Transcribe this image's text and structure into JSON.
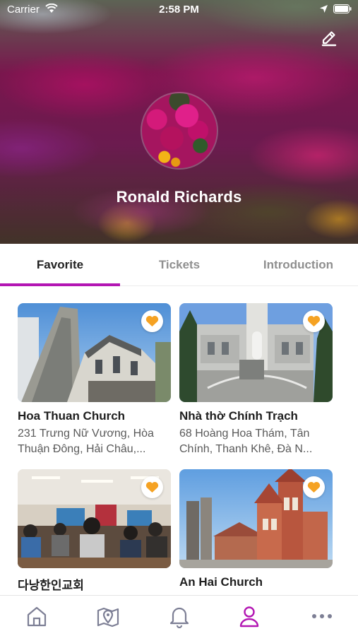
{
  "status_bar": {
    "carrier": "Carrier",
    "time": "2:58 PM"
  },
  "profile": {
    "name": "Ronald Richards"
  },
  "tabs": [
    {
      "label": "Favorite",
      "active": true
    },
    {
      "label": "Tickets",
      "active": false
    },
    {
      "label": "Introduction",
      "active": false
    }
  ],
  "favorites": [
    {
      "title": "Hoa Thuan Church",
      "address_line1": "231 Trưng Nữ Vương, Hòa",
      "address_line2": "Thuận Đông, Hải Châu,...",
      "favorited": true
    },
    {
      "title": "Nhà thờ Chính Trạch",
      "address_line1": "68 Hoàng Hoa Thám, Tân",
      "address_line2": "Chính, Thanh Khê, Đà N...",
      "favorited": true
    },
    {
      "title": "다낭한인교회",
      "address_line1": "",
      "address_line2": "",
      "favorited": true
    },
    {
      "title": "An Hai Church",
      "address_line1": "",
      "address_line2": "",
      "favorited": true
    }
  ],
  "colors": {
    "accent": "#b316b3",
    "heart": "#f5a223",
    "nav_inactive": "#7d7f95"
  },
  "bottom_nav": [
    {
      "icon": "home-icon",
      "active": false
    },
    {
      "icon": "map-pin-icon",
      "active": false
    },
    {
      "icon": "bell-icon",
      "active": false
    },
    {
      "icon": "profile-icon",
      "active": true
    },
    {
      "icon": "more-icon",
      "active": false
    }
  ]
}
